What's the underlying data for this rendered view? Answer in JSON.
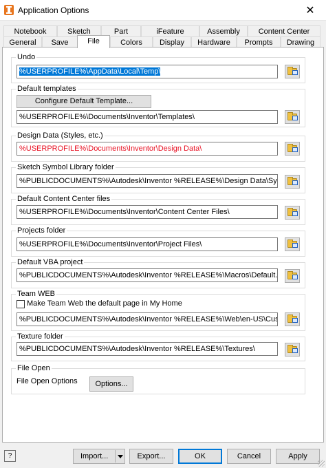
{
  "window": {
    "title": "Application Options",
    "close_glyph": "✕"
  },
  "tabs": {
    "row1": [
      "Notebook",
      "Sketch",
      "Part",
      "iFeature",
      "Assembly",
      "Content Center"
    ],
    "row2": [
      "General",
      "Save",
      "File",
      "Colors",
      "Display",
      "Hardware",
      "Prompts",
      "Drawing"
    ],
    "active": "File"
  },
  "groups": {
    "undo": {
      "label": "Undo",
      "path": "%USERPROFILE%\\AppData\\Local\\Temp\\"
    },
    "templates": {
      "label": "Default templates",
      "button": "Configure Default Template...",
      "path": "%USERPROFILE%\\Documents\\Inventor\\Templates\\"
    },
    "design_data": {
      "label": "Design Data (Styles, etc.)",
      "path": "%USERPROFILE%\\Documents\\Inventor\\Design Data\\",
      "color": "#e81123"
    },
    "sketch_symbol": {
      "label": "Sketch Symbol Library folder",
      "path": "%PUBLICDOCUMENTS%\\Autodesk\\Inventor %RELEASE%\\Design Data\\Symbol Library\\"
    },
    "content_center": {
      "label": "Default Content Center files",
      "path": "%USERPROFILE%\\Documents\\Inventor\\Content Center Files\\"
    },
    "projects": {
      "label": "Projects folder",
      "path": "%USERPROFILE%\\Documents\\Inventor\\Project Files\\"
    },
    "vba": {
      "label": "Default VBA project",
      "path": "%PUBLICDOCUMENTS%\\Autodesk\\Inventor %RELEASE%\\Macros\\Default.ivb"
    },
    "team_web": {
      "label": "Team WEB",
      "checkbox_label": "Make Team Web the default page in My Home",
      "checked": false,
      "path": "%PUBLICDOCUMENTS%\\Autodesk\\Inventor %RELEASE%\\Web\\en-US\\CustomHelpSample\\"
    },
    "texture": {
      "label": "Texture folder",
      "path": "%PUBLICDOCUMENTS%\\Autodesk\\Inventor %RELEASE%\\Textures\\"
    },
    "file_open": {
      "label": "File Open",
      "options_label": "File Open Options",
      "button": "Options..."
    }
  },
  "footer": {
    "help_glyph": "?",
    "import": "Import...",
    "export": "Export...",
    "ok": "OK",
    "cancel": "Cancel",
    "apply": "Apply"
  },
  "colors": {
    "selection": "#0078d7",
    "error_text": "#e81123",
    "close_accent": "#e81123"
  }
}
